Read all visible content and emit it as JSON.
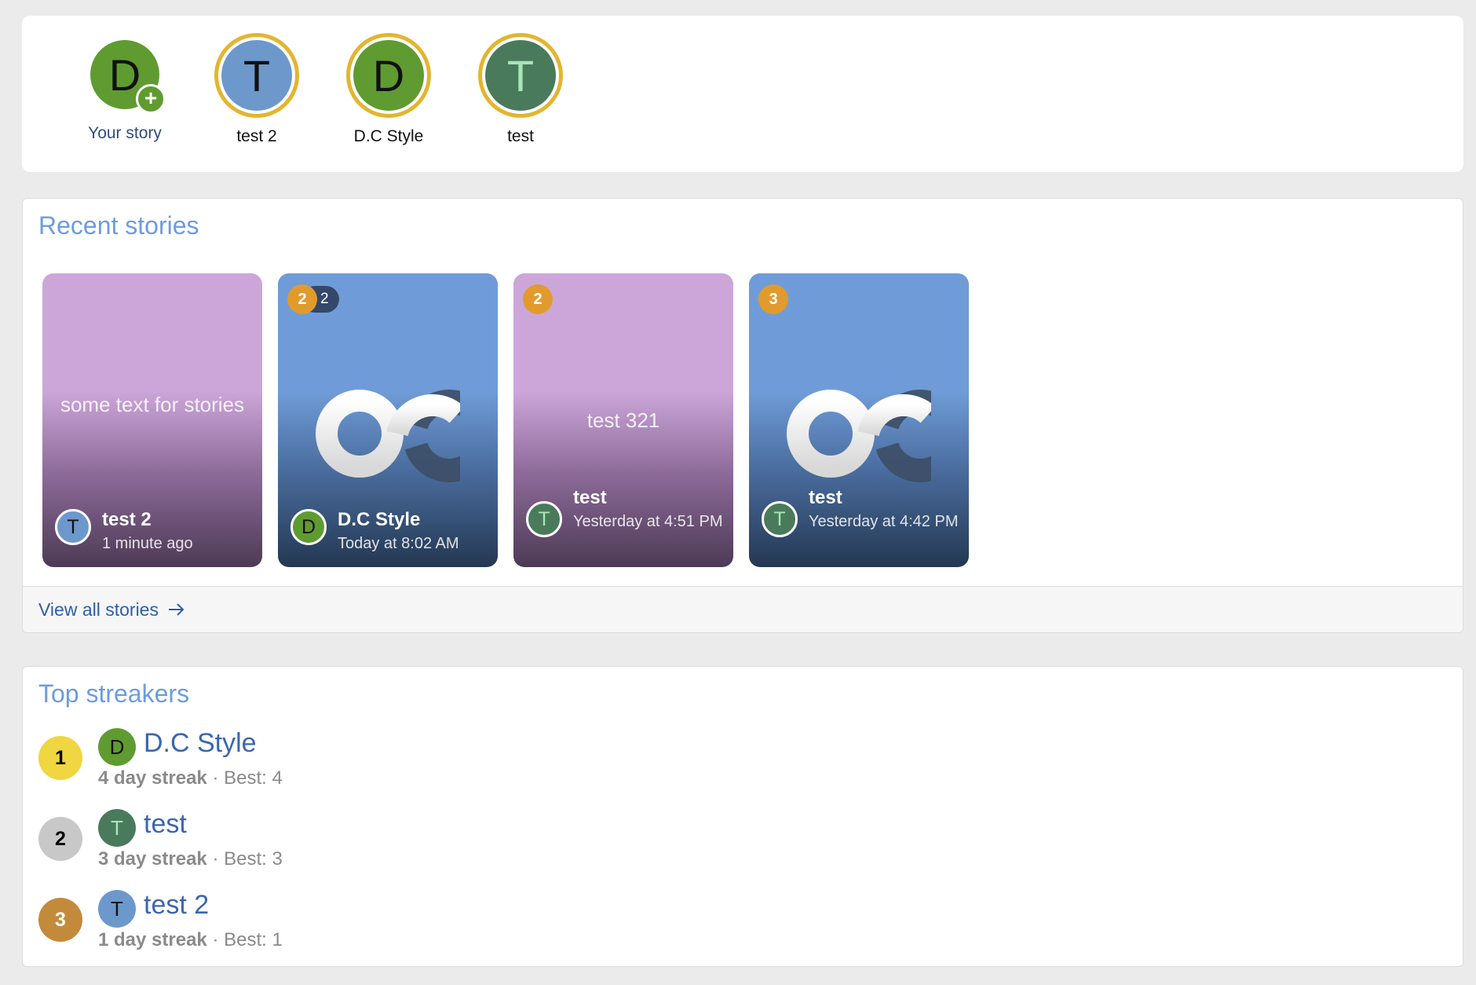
{
  "stories_bar": {
    "items": [
      {
        "initial": "D",
        "label": "Your story",
        "color": "#5f9b31",
        "own": true
      },
      {
        "initial": "T",
        "label": "test 2",
        "color": "#6d98cc"
      },
      {
        "initial": "D",
        "label": "D.C Style",
        "color": "#5f9b31"
      },
      {
        "initial": "T",
        "label": "test",
        "color": "#4a7a5c"
      }
    ],
    "plus_symbol": "+"
  },
  "recent": {
    "title": "Recent stories",
    "cards": [
      {
        "theme": "purple",
        "text": "some text for stories",
        "author": "test 2",
        "initial": "T",
        "avatar_color": "#6d98cc",
        "time": "1 minute ago"
      },
      {
        "theme": "blue",
        "logo": true,
        "badge": "2",
        "pill": "2",
        "author": "D.C Style",
        "initial": "D",
        "avatar_color": "#5f9b31",
        "time": "Today at 8:02 AM"
      },
      {
        "theme": "purple",
        "text": "test 321",
        "badge": "2",
        "author": "test",
        "initial": "T",
        "avatar_color": "#4a7a5c",
        "time": "Yesterday at 4:51 PM"
      },
      {
        "theme": "blue",
        "logo": true,
        "badge": "3",
        "author": "test",
        "initial": "T",
        "avatar_color": "#4a7a5c",
        "time": "Yesterday at 4:42 PM"
      }
    ],
    "view_all": "View all stories"
  },
  "streakers": {
    "title": "Top streakers",
    "rows": [
      {
        "rank": "1",
        "rank_color": "#f0d640",
        "initial": "D",
        "avatar_color": "#5f9b31",
        "name": "D.C Style",
        "streak": "4 day streak",
        "sep": "·",
        "best": "Best: 4"
      },
      {
        "rank": "2",
        "rank_color": "#c8c8c8",
        "initial": "T",
        "avatar_color": "#4a7a5c",
        "name": "test",
        "streak": "3 day streak",
        "sep": "·",
        "best": "Best: 3"
      },
      {
        "rank": "3",
        "rank_color": "#c48a3c",
        "initial": "T",
        "avatar_color": "#6d98cc",
        "name": "test 2",
        "streak": "1 day streak",
        "sep": "·",
        "best": "Best: 1"
      }
    ]
  }
}
